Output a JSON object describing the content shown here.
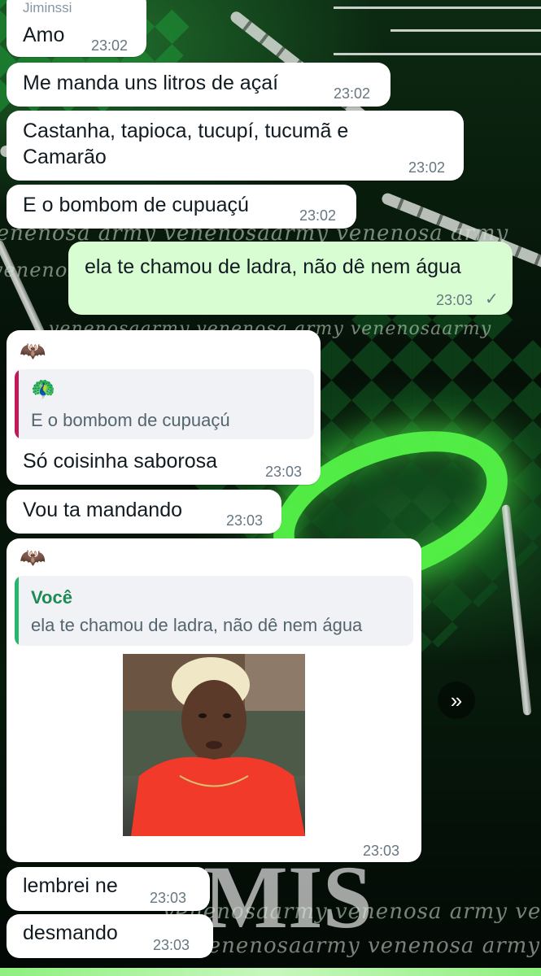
{
  "messages": [
    {
      "sender": "Jiminssi",
      "text": "Amo",
      "time": "23:02"
    },
    {
      "text": "Me manda uns litros de açaí",
      "time": "23:02"
    },
    {
      "text_line1": "Castanha, tapioca, tucupí, tucumã e",
      "text_line2": "Camarão",
      "time": "23:02"
    },
    {
      "text": "E o bombom de cupuaçú",
      "time": "23:02"
    },
    {
      "text": "ela te chamou de ladra, não dê nem água",
      "time": "23:03",
      "status_icon": "single-check-icon"
    },
    {
      "avatar_emoji": "🦇",
      "quote_emoji": "🦚",
      "quote_text": "E o bombom de cupuaçú",
      "text": "Só coisinha saborosa",
      "time": "23:03"
    },
    {
      "text": "Vou ta mandando",
      "time": "23:03"
    },
    {
      "avatar_emoji": "🦇",
      "quote_name": "Você",
      "quote_text": "ela te chamou de ladra, não dê nem água",
      "time": "23:03"
    },
    {
      "text": "lembrei ne",
      "time": "23:03"
    },
    {
      "text": "desmando",
      "time": "23:03"
    }
  ],
  "wallpaper": {
    "watermark_1": "venenosa army venenosaarmy venenosa army",
    "watermark_2": "venenosa army venenosa army",
    "watermark_3": "venenosaarmy venenosa army venenosaarmy",
    "watermark_4": "venenosaarmy venenosa army venenosaar",
    "watermark_5": "venenosaarmy venenosa army venenosaa",
    "big_letters": "MIS"
  },
  "colors": {
    "incoming_bubble": "#ffffff",
    "outgoing_bubble": "#d9fdd3",
    "quote_bar_pink": "#c2185b",
    "quote_bar_green": "#25b86b",
    "quote_name": "#1e8a55",
    "accent_glow": "#59ff4a"
  }
}
